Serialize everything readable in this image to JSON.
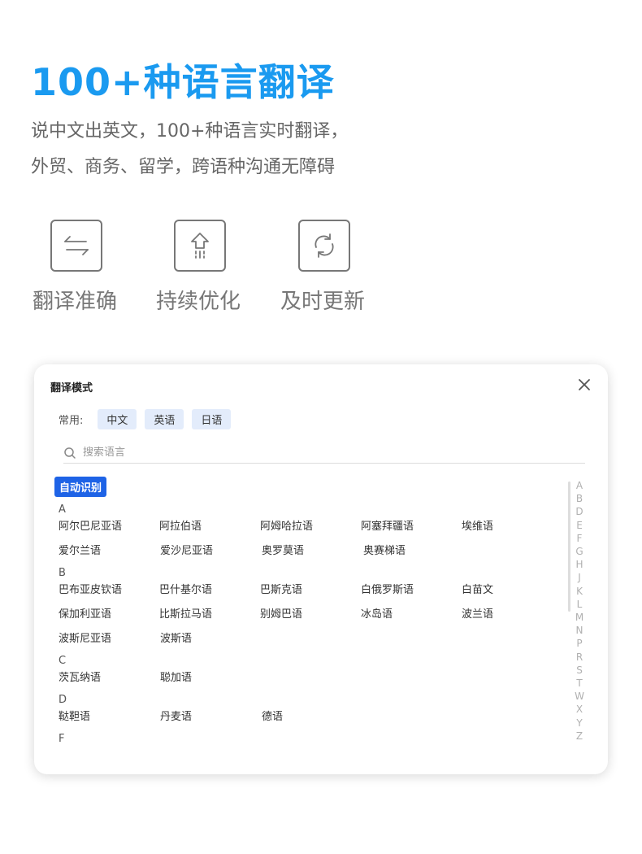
{
  "hero": {
    "title": "100+种语言翻译",
    "desc_line1": "说中文出英文，100+种语言实时翻译，",
    "desc_line2": "外贸、商务、留学，跨语种沟通无障碍"
  },
  "features": [
    {
      "label": "翻译准确",
      "icon": "swap-arrows-icon"
    },
    {
      "label": "持续优化",
      "icon": "upgrade-arrow-icon"
    },
    {
      "label": "及时更新",
      "icon": "refresh-icon"
    }
  ],
  "dialog": {
    "title": "翻译模式",
    "common_label": "常用:",
    "common_langs": [
      "中文",
      "英语",
      "日语"
    ],
    "search_placeholder": "搜索语言",
    "auto_detect": "自动识别",
    "groups": [
      {
        "letter": "A",
        "rows": [
          [
            "阿尔巴尼亚语",
            "阿拉伯语",
            "阿姆哈拉语",
            "阿塞拜疆语",
            "埃维语"
          ],
          [
            "爱尔兰语",
            "爱沙尼亚语",
            "奥罗莫语",
            "奥赛梯语"
          ]
        ]
      },
      {
        "letter": "B",
        "rows": [
          [
            "巴布亚皮钦语",
            "巴什基尔语",
            "巴斯克语",
            "白俄罗斯语",
            "白苗文"
          ],
          [
            "保加利亚语",
            "比斯拉马语",
            "别姆巴语",
            "冰岛语",
            "波兰语"
          ],
          [
            "波斯尼亚语",
            "波斯语"
          ]
        ]
      },
      {
        "letter": "C",
        "rows": [
          [
            "茨瓦纳语",
            "聪加语"
          ]
        ]
      },
      {
        "letter": "D",
        "rows": [
          [
            "鞑靼语",
            "丹麦语",
            "德语"
          ]
        ]
      },
      {
        "letter": "F",
        "rows": []
      }
    ],
    "alphabet": [
      "A",
      "B",
      "D",
      "E",
      "F",
      "G",
      "H",
      "J",
      "K",
      "L",
      "M",
      "N",
      "P",
      "R",
      "S",
      "T",
      "W",
      "X",
      "Y",
      "Z"
    ]
  }
}
